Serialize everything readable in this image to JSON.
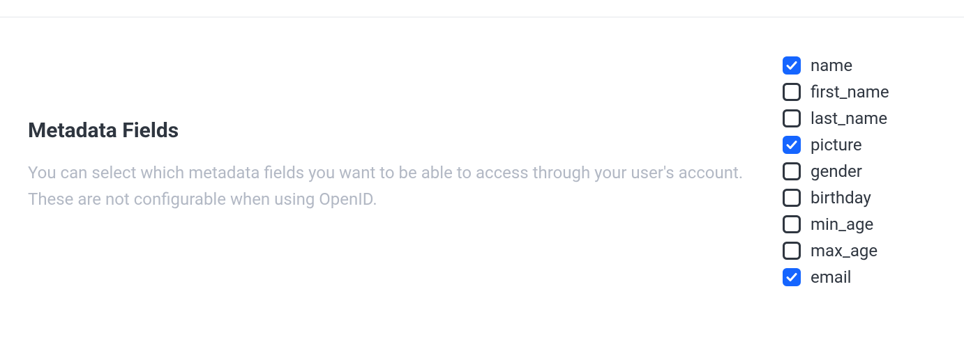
{
  "section": {
    "title": "Metadata Fields",
    "description": "You can select which metadata fields you want to be able to access through your user's account. These are not configurable when using OpenID."
  },
  "fields": [
    {
      "label": "name",
      "checked": true
    },
    {
      "label": "first_name",
      "checked": false
    },
    {
      "label": "last_name",
      "checked": false
    },
    {
      "label": "picture",
      "checked": true
    },
    {
      "label": "gender",
      "checked": false
    },
    {
      "label": "birthday",
      "checked": false
    },
    {
      "label": "min_age",
      "checked": false
    },
    {
      "label": "max_age",
      "checked": false
    },
    {
      "label": "email",
      "checked": true
    }
  ]
}
